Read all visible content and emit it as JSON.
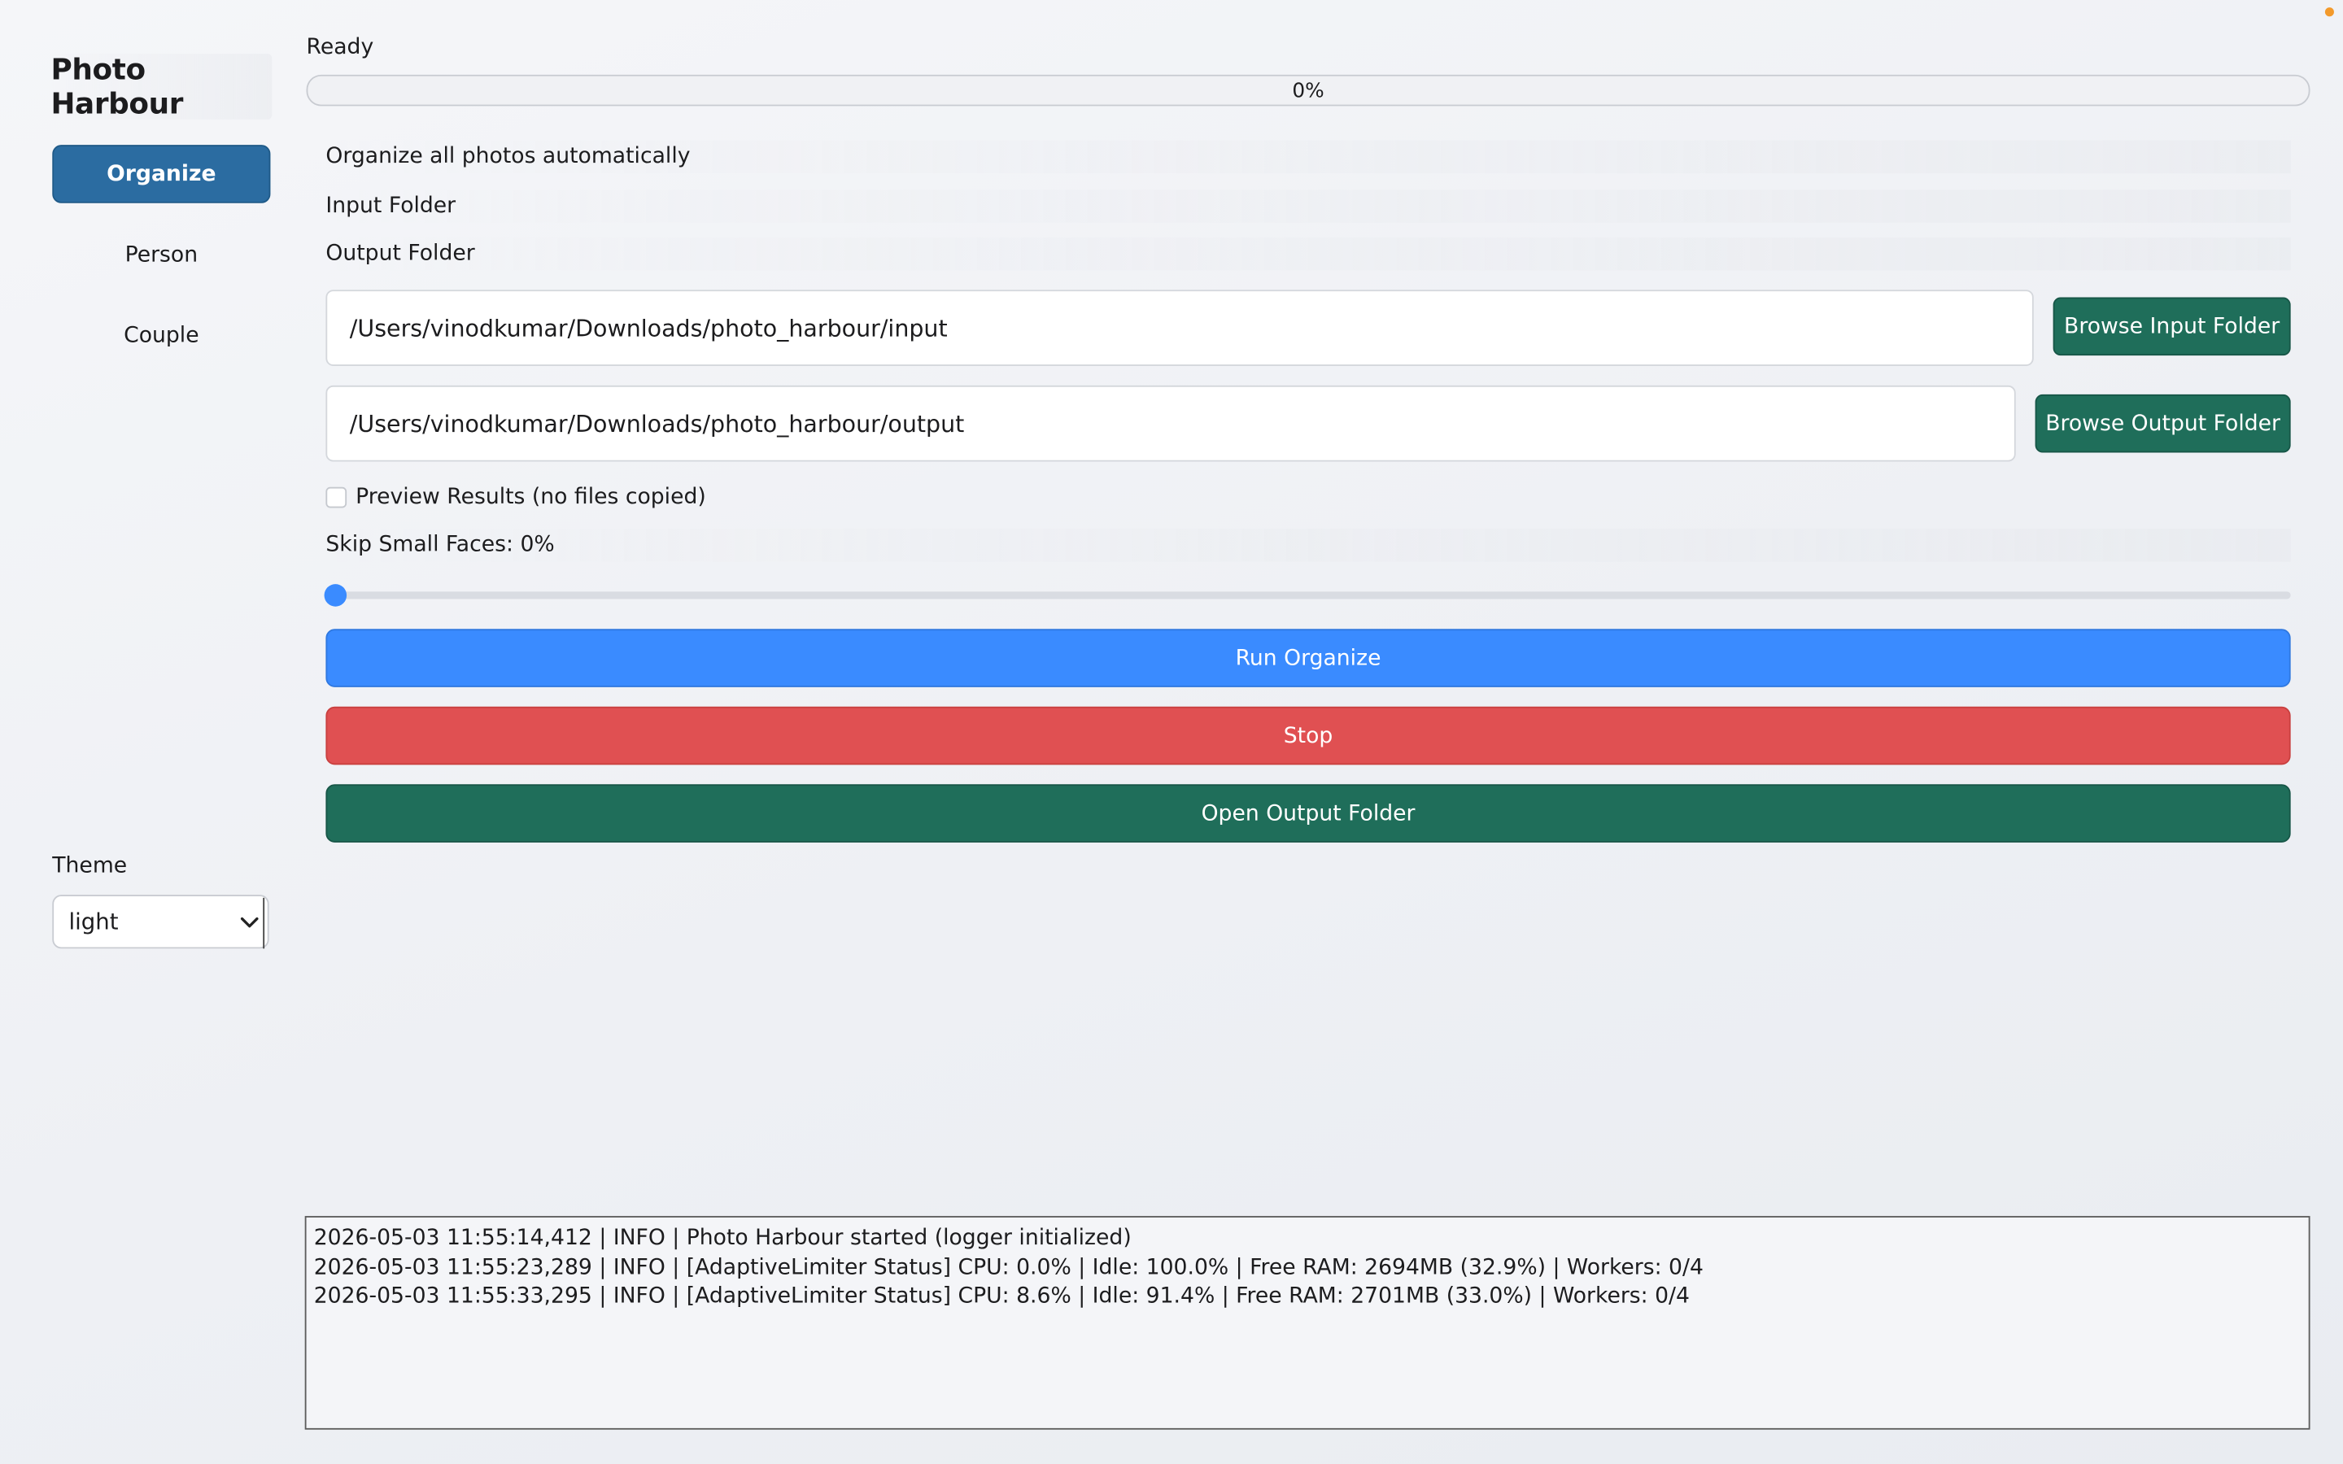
{
  "app": {
    "title": "Photo Harbour"
  },
  "sidebar": {
    "items": [
      {
        "label": "Organize",
        "active": true
      },
      {
        "label": "Person",
        "active": false
      },
      {
        "label": "Couple",
        "active": false
      }
    ],
    "theme_label": "Theme",
    "theme_value": "light"
  },
  "status": {
    "text": "Ready",
    "progress_label": "0%",
    "progress_fraction": 0
  },
  "organize": {
    "heading": "Organize all photos automatically",
    "input_label": "Input Folder",
    "output_label": "Output Folder",
    "input_path": "/Users/vinodkumar/Downloads/photo_harbour/input",
    "output_path": "/Users/vinodkumar/Downloads/photo_harbour/output",
    "browse_input_label": "Browse Input Folder",
    "browse_output_label": "Browse Output Folder",
    "preview_label": "Preview Results (no files copied)",
    "preview_checked": false,
    "skip_label": "Skip Small Faces: 0%",
    "skip_fraction": 0,
    "run_label": "Run Organize",
    "stop_label": "Stop",
    "open_output_label": "Open Output Folder"
  },
  "log": {
    "lines": [
      "2026-05-03 11:55:14,412 | INFO | Photo Harbour started (logger initialized)",
      "2026-05-03 11:55:23,289 | INFO | [AdaptiveLimiter Status] CPU: 0.0% | Idle: 100.0% | Free RAM: 2694MB (32.9%) | Workers: 0/4",
      "2026-05-03 11:55:33,295 | INFO | [AdaptiveLimiter Status] CPU: 8.6% | Idle: 91.4% | Free RAM: 2701MB (33.0%) | Workers: 0/4"
    ]
  },
  "colors": {
    "nav_active": "#2b6ca1",
    "primary": "#3a8bff",
    "danger": "#e05052",
    "success": "#1f6e5a",
    "indicator": "#f39a2b"
  }
}
